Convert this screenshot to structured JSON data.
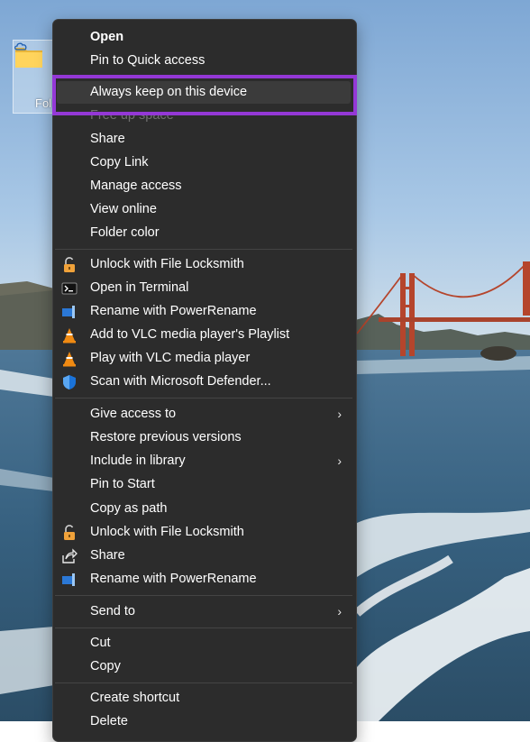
{
  "desktop": {
    "folder_icon": "folder-icon",
    "cloud_icon": "cloud-icon",
    "folder_label": "Fol"
  },
  "menu": {
    "open": "Open",
    "pin_quick_access": "Pin to Quick access",
    "always_keep": "Always keep on this device",
    "free_up_space": "Free up space",
    "share": "Share",
    "copy_link": "Copy Link",
    "manage_access": "Manage access",
    "view_online": "View online",
    "folder_color": "Folder color",
    "unlock_locksmith": "Unlock with File Locksmith",
    "open_terminal": "Open in Terminal",
    "rename_powerrename": "Rename with PowerRename",
    "add_vlc_playlist": "Add to VLC media player's Playlist",
    "play_vlc": "Play with VLC media player",
    "scan_defender": "Scan with Microsoft Defender...",
    "give_access": "Give access to",
    "restore_versions": "Restore previous versions",
    "include_library": "Include in library",
    "pin_start": "Pin to Start",
    "copy_as_path": "Copy as path",
    "unlock_locksmith_2": "Unlock with File Locksmith",
    "share_2": "Share",
    "rename_powerrename_2": "Rename with PowerRename",
    "send_to": "Send to",
    "cut": "Cut",
    "copy": "Copy",
    "create_shortcut": "Create shortcut",
    "delete": "Delete",
    "submenu_chevron": "›"
  },
  "colors": {
    "menu_background": "#2c2c2c",
    "highlight_frame": "#9438d6",
    "sky": "#8fb8dc",
    "sea": "#3d6486",
    "bridge": "#b5452c"
  }
}
